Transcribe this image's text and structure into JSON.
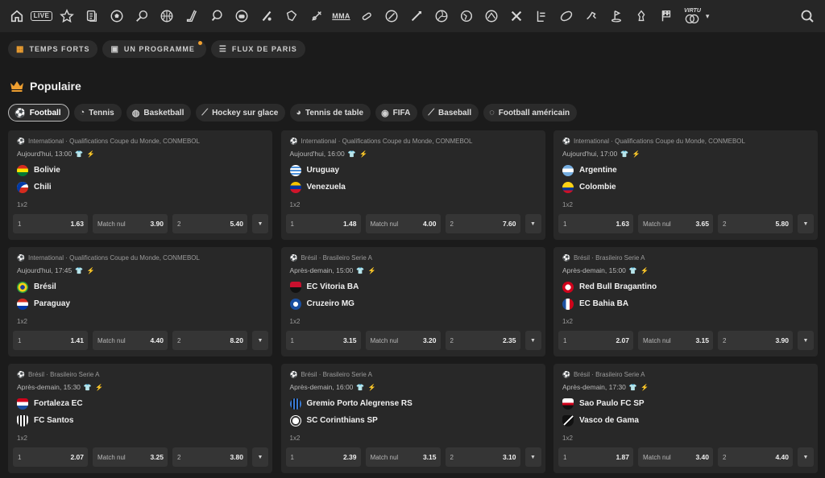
{
  "nav": {
    "icons": [
      "home-icon",
      "live-icon",
      "star-icon",
      "betslip-icon",
      "soccer-icon",
      "tennis-icon",
      "basketball-icon",
      "hockey-icon",
      "table-tennis-icon",
      "fifa-icon",
      "baseball-icon",
      "american-football-icon",
      "mma-icon",
      "boxing-icon",
      "esports-icon",
      "badminton-icon",
      "volleyball-icon",
      "handball-icon",
      "darts-icon",
      "motorsport-icon",
      "cricket-icon",
      "rugby-icon",
      "skiing-icon",
      "horse-racing-icon",
      "chess-icon",
      "formula-icon",
      "virtual-icon"
    ],
    "live_label": "LIVE",
    "mma_label": "MMA",
    "virtual_label": "VIRTU",
    "search_icon": "search-icon"
  },
  "tabs": [
    {
      "label": "TEMPS FORTS",
      "icon": "grid-icon"
    },
    {
      "label": "UN PROGRAMME",
      "icon": "calendar-icon"
    },
    {
      "label": "FLUX DE PARIS",
      "icon": "list-icon"
    }
  ],
  "section": {
    "title": "Populaire",
    "icon": "crown-icon"
  },
  "sports": [
    {
      "label": "Football",
      "icon": "soccer-icon"
    },
    {
      "label": "Tennis",
      "icon": "tennis-icon"
    },
    {
      "label": "Basketball",
      "icon": "basketball-icon"
    },
    {
      "label": "Hockey sur glace",
      "icon": "hockey-icon"
    },
    {
      "label": "Tennis de table",
      "icon": "table-tennis-icon"
    },
    {
      "label": "FIFA",
      "icon": "fifa-icon"
    },
    {
      "label": "Baseball",
      "icon": "baseball-icon"
    },
    {
      "label": "Football américain",
      "icon": "american-football-icon"
    }
  ],
  "market_label": "1x2",
  "draw_label": "Match nul",
  "home_label": "1",
  "away_label": "2",
  "matches": [
    {
      "meta": "International · Qualifications Coupe du Monde, CONMEBOL",
      "time": "Aujourd'hui, 13:00",
      "home": "Bolivie",
      "away": "Chili",
      "odds": [
        "1.63",
        "3.90",
        "5.40"
      ]
    },
    {
      "meta": "International · Qualifications Coupe du Monde, CONMEBOL",
      "time": "Aujourd'hui, 16:00",
      "home": "Uruguay",
      "away": "Venezuela",
      "odds": [
        "1.48",
        "4.00",
        "7.60"
      ]
    },
    {
      "meta": "International · Qualifications Coupe du Monde, CONMEBOL",
      "time": "Aujourd'hui, 17:00",
      "home": "Argentine",
      "away": "Colombie",
      "odds": [
        "1.63",
        "3.65",
        "5.80"
      ]
    },
    {
      "meta": "International · Qualifications Coupe du Monde, CONMEBOL",
      "time": "Aujourd'hui, 17:45",
      "home": "Brésil",
      "away": "Paraguay",
      "odds": [
        "1.41",
        "4.40",
        "8.20"
      ]
    },
    {
      "meta": "Brésil · Brasileiro Serie A",
      "time": "Après-demain, 15:00",
      "home": "EC Vitoria BA",
      "away": "Cruzeiro MG",
      "odds": [
        "3.15",
        "3.20",
        "2.35"
      ]
    },
    {
      "meta": "Brésil · Brasileiro Serie A",
      "time": "Après-demain, 15:00",
      "home": "Red Bull Bragantino",
      "away": "EC Bahia BA",
      "odds": [
        "2.07",
        "3.15",
        "3.90"
      ]
    },
    {
      "meta": "Brésil · Brasileiro Serie A",
      "time": "Après-demain, 15:30",
      "home": "Fortaleza EC",
      "away": "FC Santos",
      "odds": [
        "2.07",
        "3.25",
        "3.80"
      ]
    },
    {
      "meta": "Brésil · Brasileiro Serie A",
      "time": "Après-demain, 16:00",
      "home": "Gremio Porto Alegrense RS",
      "away": "SC Corinthians SP",
      "odds": [
        "2.39",
        "3.15",
        "3.10"
      ]
    },
    {
      "meta": "Brésil · Brasileiro Serie A",
      "time": "Après-demain, 17:30",
      "home": "Sao Paulo FC SP",
      "away": "Vasco de Gama",
      "odds": [
        "1.87",
        "3.40",
        "4.40"
      ]
    }
  ],
  "colors": {
    "accent": "#f0a030",
    "tag_blue": "#4aa3ff",
    "card_bg": "#282828",
    "odd_bg": "#353535"
  }
}
